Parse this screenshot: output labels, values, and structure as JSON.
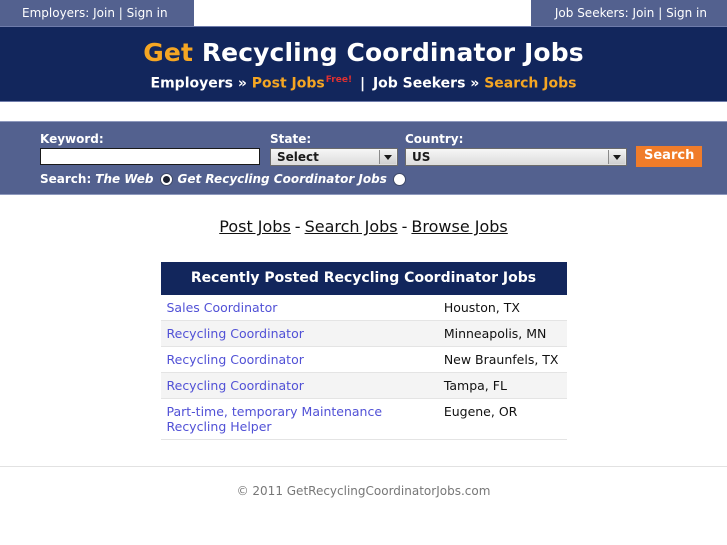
{
  "topbar": {
    "employers": {
      "prefix": "Employers:",
      "join": "Join",
      "divider": "|",
      "signin": "Sign in"
    },
    "jobseekers": {
      "prefix": "Job Seekers:",
      "join": "Join",
      "divider": "|",
      "signin": "Sign in"
    }
  },
  "masthead": {
    "title_accent": "Get",
    "title_rest": " Recycling Coordinator Jobs",
    "nav": {
      "employers_label": "Employers",
      "arrow1": "»",
      "post_jobs": "Post Jobs",
      "free_badge": "Free!",
      "pipe": "|",
      "jobseekers_label": "Job Seekers",
      "arrow2": "»",
      "search_jobs": "Search Jobs"
    }
  },
  "search": {
    "keyword_label": "Keyword:",
    "keyword_value": "",
    "keyword_placeholder": "",
    "state_label": "State:",
    "state_value": "Select",
    "country_label": "Country:",
    "country_value": "US",
    "search_button": "Search",
    "scope_lead": "Search:",
    "scope_web": "The Web",
    "scope_site": "Get Recycling Coordinator Jobs",
    "accent_color": "#f07c2a",
    "panel_color": "#53618f"
  },
  "quicklinks": {
    "post_jobs": "Post Jobs",
    "dash1": "-",
    "search_jobs": "Search Jobs",
    "dash2": "-",
    "browse_jobs": "Browse Jobs"
  },
  "listings": {
    "header": "Recently Posted Recycling Coordinator Jobs",
    "rows": [
      {
        "title": "Sales Coordinator",
        "location": "Houston, TX"
      },
      {
        "title": "Recycling Coordinator",
        "location": "Minneapolis, MN"
      },
      {
        "title": "Recycling Coordinator",
        "location": "New Braunfels, TX"
      },
      {
        "title": "Recycling Coordinator",
        "location": "Tampa, FL"
      },
      {
        "title": "Part-time, temporary Maintenance Recycling Helper",
        "location": "Eugene, OR"
      }
    ]
  },
  "footer": {
    "copyright": "© 2011 GetRecyclingCoordinatorJobs.com"
  }
}
